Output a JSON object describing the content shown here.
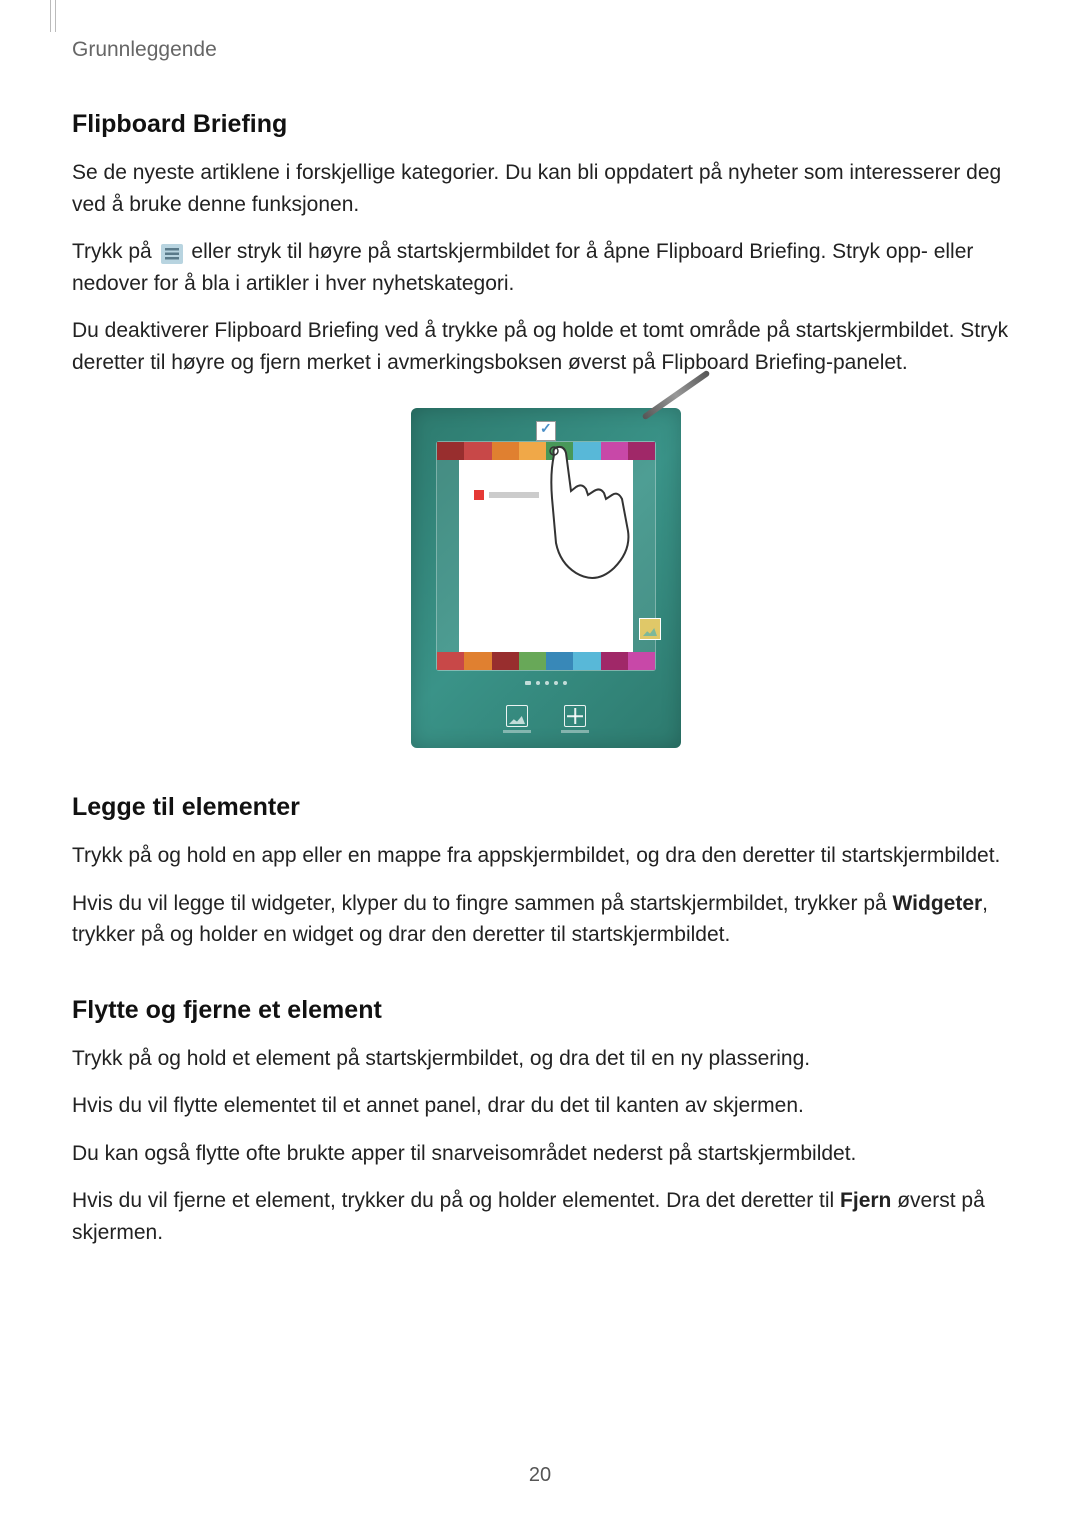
{
  "header": {
    "breadcrumb": "Grunnleggende"
  },
  "sections": {
    "flipboard": {
      "heading": "Flipboard Briefing",
      "p1": "Se de nyeste artiklene i forskjellige kategorier. Du kan bli oppdatert på nyheter som interesserer deg ved å bruke denne funksjonen.",
      "p2_pre": "Trykk på ",
      "p2_post": " eller stryk til høyre på startskjermbildet for å åpne Flipboard Briefing. Stryk opp- eller nedover for å bla i artikler i hver nyhetskategori.",
      "p3": "Du deaktiverer Flipboard Briefing ved å trykke på og holde et tomt område på startskjermbildet. Stryk deretter til høyre og fjern merket i avmerkingsboksen øverst på Flipboard Briefing-panelet."
    },
    "add_elements": {
      "heading": "Legge til elementer",
      "p1": "Trykk på og hold en app eller en mappe fra appskjermbildet, og dra den deretter til startskjermbildet.",
      "p2_pre": "Hvis du vil legge til widgeter, klyper du to fingre sammen på startskjermbildet, trykker på ",
      "p2_bold": "Widgeter",
      "p2_post": ", trykker på og holder en widget og drar den deretter til startskjermbildet."
    },
    "move_remove": {
      "heading": "Flytte og fjerne et element",
      "p1": "Trykk på og hold et element på startskjermbildet, og dra det til en ny plassering.",
      "p2": "Hvis du vil flytte elementet til et annet panel, drar du det til kanten av skjermen.",
      "p3": "Du kan også flytte ofte brukte apper til snarveisområdet nederst på startskjermbildet.",
      "p4_pre": "Hvis du vil fjerne et element, trykker du på og holder elementet. Dra det deretter til ",
      "p4_bold": "Fjern",
      "p4_post": " øverst på skjermen."
    }
  },
  "illustration": {
    "colors_top": [
      "#982e2e",
      "#c84848",
      "#e08030",
      "#f0a848",
      "#489858",
      "#58b8d8",
      "#c848a8",
      "#a02868"
    ],
    "colors_bottom": [
      "#c84848",
      "#e08030",
      "#982e2e",
      "#68a858",
      "#3888b8",
      "#58b8d8",
      "#a02868",
      "#c848a8"
    ]
  },
  "page_number": "20"
}
